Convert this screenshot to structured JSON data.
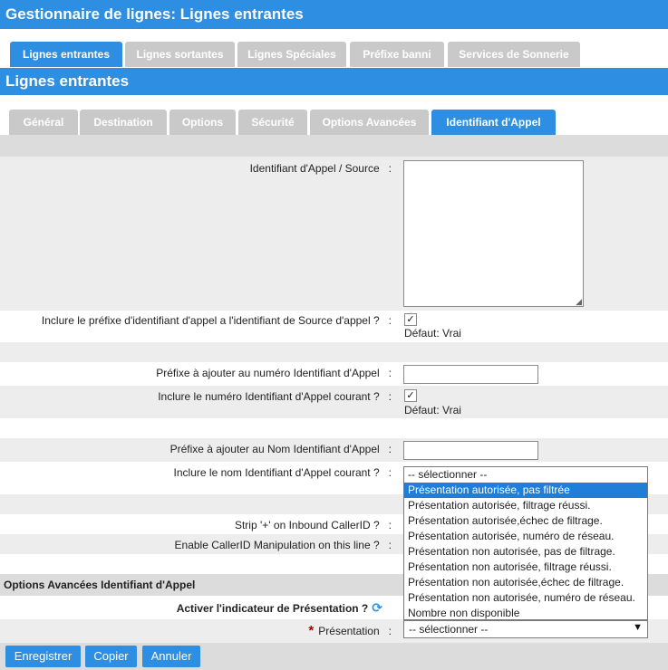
{
  "title": "Gestionnaire de lignes:  Lignes entrantes",
  "top_tabs": [
    {
      "label": "Lignes entrantes"
    },
    {
      "label": "Lignes sortantes"
    },
    {
      "label": "Lignes Spéciales"
    },
    {
      "label": "Préfixe banni"
    },
    {
      "label": "Services de Sonnerie"
    }
  ],
  "section_title": "Lignes entrantes",
  "sub_tabs": [
    {
      "label": "Général"
    },
    {
      "label": "Destination"
    },
    {
      "label": "Options"
    },
    {
      "label": "Sécurité"
    },
    {
      "label": "Options Avancées"
    },
    {
      "label": "Identifiant d'Appel"
    }
  ],
  "form": {
    "cid_source_label": "Identifiant d'Appel / Source",
    "include_prefix_label": "Inclure le préfixe d'identifiant d'appel a l'identifiant de Source d'appel ?",
    "include_prefix_default": "Défaut: Vrai",
    "prefix_number_label": "Préfixe à ajouter au numéro Identifiant d'Appel",
    "include_number_label": "Inclure le numéro Identifiant d'Appel courant ?",
    "include_number_default": "Défaut: Vrai",
    "prefix_name_label": "Préfixe à ajouter au Nom Identifiant d'Appel",
    "include_name_label": "Inclure le nom Identifiant d'Appel courant ?",
    "strip_plus_label": "Strip '+' on Inbound CallerID ?",
    "enable_manip_label": "Enable CallerID Manipulation on this line ?",
    "colon": ":"
  },
  "advanced": {
    "header": "Options Avancées Identifiant d'Appel",
    "indicator_label": "Activer l'indicateur de Présentation ?",
    "presentation_label": "Présentation",
    "required_mark": "*",
    "presentation_value": "-- sélectionner --",
    "dropdown_options": [
      "-- sélectionner --",
      "Présentation autorisée, pas filtrée",
      "Présentation autorisée, filtrage réussi.",
      "Présentation autorisée,échec de filtrage.",
      "Présentation autorisée, numéro de réseau.",
      "Présentation non autorisée, pas de filtrage.",
      "Présentation non autorisée, filtrage réussi.",
      "Présentation non autorisée,échec de filtrage.",
      "Présentation non autorisée, numéro de réseau.",
      "Nombre non disponible"
    ],
    "highlighted_option_index": 1
  },
  "buttons": {
    "save": "Enregistrer",
    "copy": "Copier",
    "cancel": "Annuler"
  },
  "icons": {
    "checkbox_checked": "✓",
    "refresh": "refresh-icon",
    "dropdown_arrow": "▼"
  }
}
